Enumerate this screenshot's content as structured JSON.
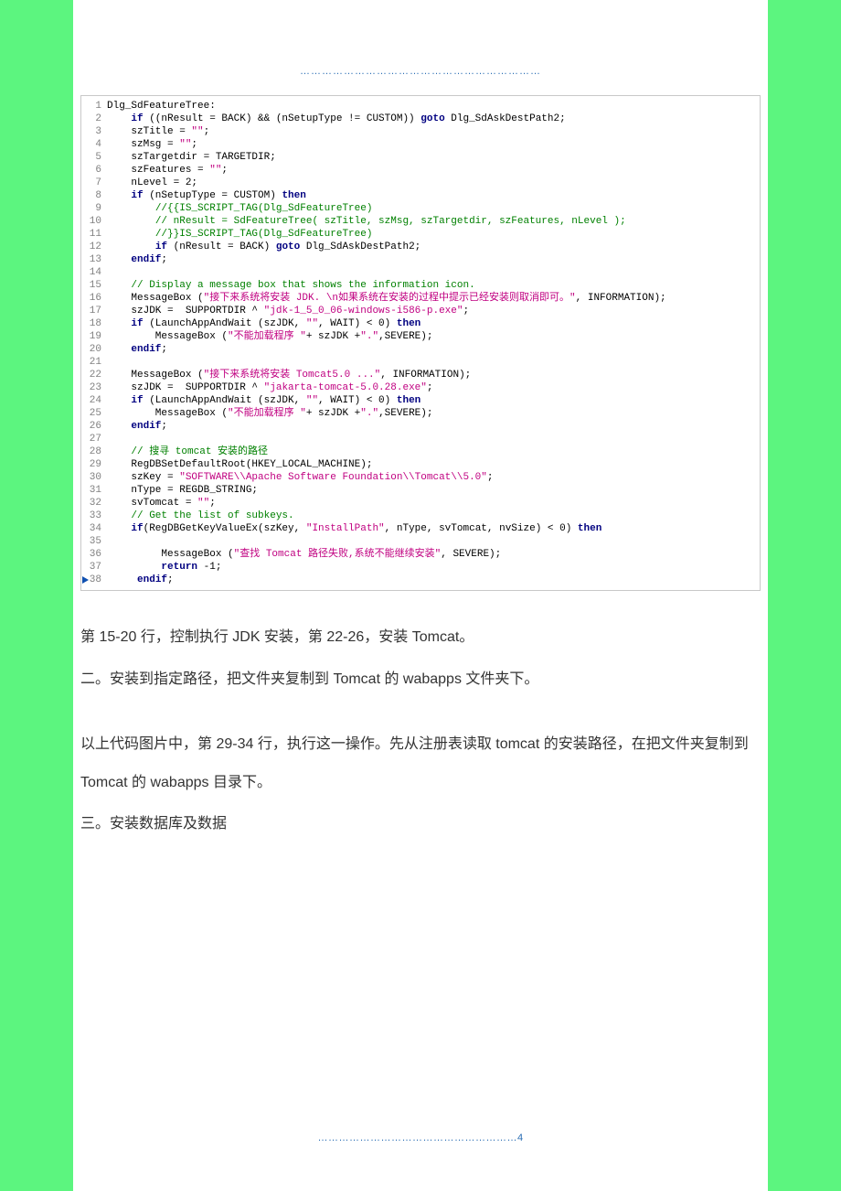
{
  "header_dots": "…………………………………………………………",
  "code": {
    "lines": [
      {
        "n": 1,
        "segs": [
          {
            "t": "Dlg_SdFeatureTree:",
            "c": ""
          }
        ]
      },
      {
        "n": 2,
        "segs": [
          {
            "t": "    ",
            "c": ""
          },
          {
            "t": "if",
            "c": "kw"
          },
          {
            "t": " ((nResult = BACK) && (nSetupType != CUSTOM)) ",
            "c": ""
          },
          {
            "t": "goto",
            "c": "kw"
          },
          {
            "t": " Dlg_SdAskDestPath2;",
            "c": ""
          }
        ]
      },
      {
        "n": 3,
        "segs": [
          {
            "t": "    szTitle = ",
            "c": ""
          },
          {
            "t": "\"\"",
            "c": "str"
          },
          {
            "t": ";",
            "c": ""
          }
        ]
      },
      {
        "n": 4,
        "segs": [
          {
            "t": "    szMsg = ",
            "c": ""
          },
          {
            "t": "\"\"",
            "c": "str"
          },
          {
            "t": ";",
            "c": ""
          }
        ]
      },
      {
        "n": 5,
        "segs": [
          {
            "t": "    szTargetdir = TARGETDIR;",
            "c": ""
          }
        ]
      },
      {
        "n": 6,
        "segs": [
          {
            "t": "    szFeatures = ",
            "c": ""
          },
          {
            "t": "\"\"",
            "c": "str"
          },
          {
            "t": ";",
            "c": ""
          }
        ]
      },
      {
        "n": 7,
        "segs": [
          {
            "t": "    nLevel = 2;",
            "c": ""
          }
        ]
      },
      {
        "n": 8,
        "segs": [
          {
            "t": "    ",
            "c": ""
          },
          {
            "t": "if",
            "c": "kw"
          },
          {
            "t": " (nSetupType = CUSTOM) ",
            "c": ""
          },
          {
            "t": "then",
            "c": "kw"
          }
        ]
      },
      {
        "n": 9,
        "segs": [
          {
            "t": "        ",
            "c": ""
          },
          {
            "t": "//{{IS_SCRIPT_TAG(Dlg_SdFeatureTree)",
            "c": "cmt"
          }
        ]
      },
      {
        "n": 10,
        "segs": [
          {
            "t": "        ",
            "c": ""
          },
          {
            "t": "// nResult = SdFeatureTree( szTitle, szMsg, szTargetdir, szFeatures, nLevel );",
            "c": "cmt"
          }
        ]
      },
      {
        "n": 11,
        "segs": [
          {
            "t": "        ",
            "c": ""
          },
          {
            "t": "//}}IS_SCRIPT_TAG(Dlg_SdFeatureTree)",
            "c": "cmt"
          }
        ]
      },
      {
        "n": 12,
        "segs": [
          {
            "t": "        ",
            "c": ""
          },
          {
            "t": "if",
            "c": "kw"
          },
          {
            "t": " (nResult = BACK) ",
            "c": ""
          },
          {
            "t": "goto",
            "c": "kw"
          },
          {
            "t": " Dlg_SdAskDestPath2;",
            "c": ""
          }
        ]
      },
      {
        "n": 13,
        "segs": [
          {
            "t": "    ",
            "c": ""
          },
          {
            "t": "endif",
            "c": "kw"
          },
          {
            "t": ";",
            "c": ""
          }
        ]
      },
      {
        "n": 14,
        "segs": [
          {
            "t": "",
            "c": ""
          }
        ]
      },
      {
        "n": 15,
        "segs": [
          {
            "t": "    ",
            "c": ""
          },
          {
            "t": "// Display a message box that shows the information icon.",
            "c": "cmt"
          }
        ]
      },
      {
        "n": 16,
        "segs": [
          {
            "t": "    MessageBox (",
            "c": ""
          },
          {
            "t": "\"接下来系统将安装 JDK. \\n如果系统在安装的过程中提示已经安装则取消即可。\"",
            "c": "str"
          },
          {
            "t": ", INFORMATION);",
            "c": ""
          }
        ]
      },
      {
        "n": 17,
        "segs": [
          {
            "t": "    szJDK =  SUPPORTDIR ^ ",
            "c": ""
          },
          {
            "t": "\"jdk-1_5_0_06-windows-i586-p.exe\"",
            "c": "str"
          },
          {
            "t": ";",
            "c": ""
          }
        ]
      },
      {
        "n": 18,
        "segs": [
          {
            "t": "    ",
            "c": ""
          },
          {
            "t": "if",
            "c": "kw"
          },
          {
            "t": " (LaunchAppAndWait (szJDK, ",
            "c": ""
          },
          {
            "t": "\"\"",
            "c": "str"
          },
          {
            "t": ", WAIT) < 0) ",
            "c": ""
          },
          {
            "t": "then",
            "c": "kw"
          }
        ]
      },
      {
        "n": 19,
        "segs": [
          {
            "t": "        MessageBox (",
            "c": ""
          },
          {
            "t": "\"不能加载程序 \"",
            "c": "str"
          },
          {
            "t": "+ szJDK +",
            "c": ""
          },
          {
            "t": "\".\"",
            "c": "str"
          },
          {
            "t": ",SEVERE);",
            "c": ""
          }
        ]
      },
      {
        "n": 20,
        "segs": [
          {
            "t": "    ",
            "c": ""
          },
          {
            "t": "endif",
            "c": "kw"
          },
          {
            "t": ";",
            "c": ""
          }
        ]
      },
      {
        "n": 21,
        "segs": [
          {
            "t": "",
            "c": ""
          }
        ]
      },
      {
        "n": 22,
        "segs": [
          {
            "t": "    MessageBox (",
            "c": ""
          },
          {
            "t": "\"接下来系统将安装 Tomcat5.0 ...\"",
            "c": "str"
          },
          {
            "t": ", INFORMATION);",
            "c": ""
          }
        ]
      },
      {
        "n": 23,
        "segs": [
          {
            "t": "    szJDK =  SUPPORTDIR ^ ",
            "c": ""
          },
          {
            "t": "\"jakarta-tomcat-5.0.28.exe\"",
            "c": "str"
          },
          {
            "t": ";",
            "c": ""
          }
        ]
      },
      {
        "n": 24,
        "segs": [
          {
            "t": "    ",
            "c": ""
          },
          {
            "t": "if",
            "c": "kw"
          },
          {
            "t": " (LaunchAppAndWait (szJDK, ",
            "c": ""
          },
          {
            "t": "\"\"",
            "c": "str"
          },
          {
            "t": ", WAIT) < 0) ",
            "c": ""
          },
          {
            "t": "then",
            "c": "kw"
          }
        ]
      },
      {
        "n": 25,
        "segs": [
          {
            "t": "        MessageBox (",
            "c": ""
          },
          {
            "t": "\"不能加载程序 \"",
            "c": "str"
          },
          {
            "t": "+ szJDK +",
            "c": ""
          },
          {
            "t": "\".\"",
            "c": "str"
          },
          {
            "t": ",SEVERE);",
            "c": ""
          }
        ]
      },
      {
        "n": 26,
        "segs": [
          {
            "t": "    ",
            "c": ""
          },
          {
            "t": "endif",
            "c": "kw"
          },
          {
            "t": ";",
            "c": ""
          }
        ]
      },
      {
        "n": 27,
        "segs": [
          {
            "t": "",
            "c": ""
          }
        ]
      },
      {
        "n": 28,
        "segs": [
          {
            "t": "    ",
            "c": ""
          },
          {
            "t": "// 搜寻 tomcat 安装的路径",
            "c": "cmt"
          }
        ]
      },
      {
        "n": 29,
        "segs": [
          {
            "t": "    RegDBSetDefaultRoot(HKEY_LOCAL_MACHINE);",
            "c": ""
          }
        ]
      },
      {
        "n": 30,
        "segs": [
          {
            "t": "    szKey = ",
            "c": ""
          },
          {
            "t": "\"SOFTWARE\\\\Apache Software Foundation\\\\Tomcat\\\\5.0\"",
            "c": "str"
          },
          {
            "t": ";",
            "c": ""
          }
        ]
      },
      {
        "n": 31,
        "segs": [
          {
            "t": "    nType = REGDB_STRING;",
            "c": ""
          }
        ]
      },
      {
        "n": 32,
        "segs": [
          {
            "t": "    svTomcat = ",
            "c": ""
          },
          {
            "t": "\"\"",
            "c": "str"
          },
          {
            "t": ";",
            "c": ""
          }
        ]
      },
      {
        "n": 33,
        "segs": [
          {
            "t": "    ",
            "c": ""
          },
          {
            "t": "// Get the list of subkeys.",
            "c": "cmt"
          }
        ]
      },
      {
        "n": 34,
        "segs": [
          {
            "t": "    ",
            "c": ""
          },
          {
            "t": "if",
            "c": "kw"
          },
          {
            "t": "(RegDBGetKeyValueEx(szKey, ",
            "c": ""
          },
          {
            "t": "\"InstallPath\"",
            "c": "str"
          },
          {
            "t": ", nType, svTomcat, nvSize) < 0) ",
            "c": ""
          },
          {
            "t": "then",
            "c": "kw"
          }
        ]
      },
      {
        "n": 35,
        "segs": [
          {
            "t": "",
            "c": ""
          }
        ]
      },
      {
        "n": 36,
        "segs": [
          {
            "t": "         MessageBox (",
            "c": ""
          },
          {
            "t": "\"查找 Tomcat 路径失败,系统不能继续安装\"",
            "c": "str"
          },
          {
            "t": ", SEVERE);",
            "c": ""
          }
        ]
      },
      {
        "n": 37,
        "segs": [
          {
            "t": "         ",
            "c": ""
          },
          {
            "t": "return",
            "c": "kw"
          },
          {
            "t": " -1;",
            "c": ""
          }
        ]
      },
      {
        "n": 38,
        "segs": [
          {
            "t": "     ",
            "c": ""
          },
          {
            "t": "endif",
            "c": "kw"
          },
          {
            "t": ";",
            "c": ""
          }
        ],
        "arrow": true
      }
    ]
  },
  "body": {
    "p1": "第 15-20 行，控制执行 JDK 安装，第 22-26，安装 Tomcat。",
    "p2": "二。安装到指定路径，把文件夹复制到 Tomcat 的 wabapps 文件夹下。",
    "p3": "以上代码图片中，第 29-34 行，执行这一操作。先从注册表读取 tomcat 的安装路径，在把文件夹复制到 Tomcat 的 wabapps 目录下。",
    "p4": "三。安装数据库及数据"
  },
  "footer_dots": "…………………………………………………4"
}
